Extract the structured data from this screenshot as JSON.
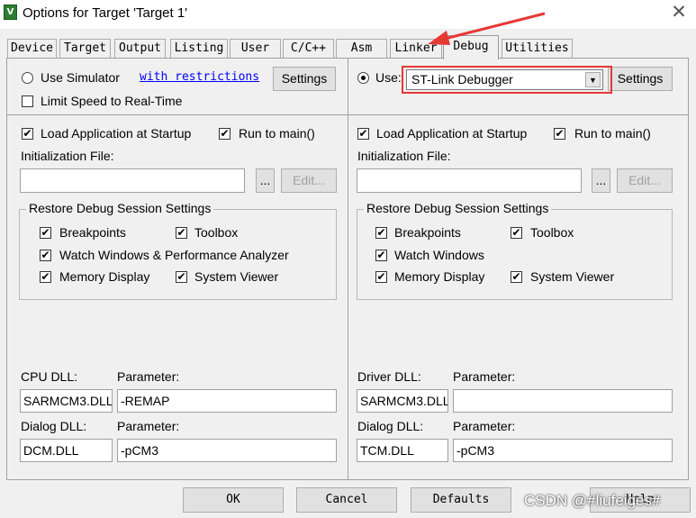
{
  "window": {
    "title": "Options for Target 'Target 1'",
    "app_icon_glyph": "V",
    "close_glyph": "✕"
  },
  "tabs": [
    "Device",
    "Target",
    "Output",
    "Listing",
    "User",
    "C/C++",
    "Asm",
    "Linker",
    "Debug",
    "Utilities"
  ],
  "active_tab": "Debug",
  "accent_color": "#e53935",
  "left": {
    "use_simulator_label": "Use Simulator",
    "use_simulator_selected": false,
    "restrictions_link": "with restrictions",
    "settings_label": "Settings",
    "limit_speed_label": "Limit Speed to Real-Time",
    "limit_speed_checked": false,
    "load_app_label": "Load Application at Startup",
    "load_app_checked": true,
    "run_main_label": "Run to main()",
    "run_main_checked": true,
    "init_file_label": "Initialization File:",
    "init_file_value": "",
    "browse_label": "...",
    "edit_label": "Edit...",
    "restore_group_title": "Restore Debug Session Settings",
    "breakpoints_label": "Breakpoints",
    "toolbox_label": "Toolbox",
    "watch_label": "Watch Windows & Performance Analyzer",
    "memory_label": "Memory Display",
    "sysviewer_label": "System Viewer",
    "dll_label": "CPU DLL:",
    "dll_value": "SARMCM3.DLL",
    "param_label": "Parameter:",
    "param_value": "-REMAP",
    "dialog_dll_label": "Dialog DLL:",
    "dialog_dll_value": "DCM.DLL",
    "dialog_param_label": "Parameter:",
    "dialog_param_value": "-pCM3"
  },
  "right": {
    "use_label": "Use:",
    "use_selected": true,
    "debugger_value": "ST-Link Debugger",
    "settings_label": "Settings",
    "load_app_label": "Load Application at Startup",
    "run_main_label": "Run to main()",
    "init_file_label": "Initialization File:",
    "init_file_value": "",
    "browse_label": "...",
    "edit_label": "Edit...",
    "restore_group_title": "Restore Debug Session Settings",
    "breakpoints_label": "Breakpoints",
    "toolbox_label": "Toolbox",
    "watch_label": "Watch Windows",
    "memory_label": "Memory Display",
    "sysviewer_label": "System Viewer",
    "dll_label": "Driver DLL:",
    "dll_value": "SARMCM3.DLL",
    "param_label": "Parameter:",
    "param_value": "",
    "dialog_dll_label": "Dialog DLL:",
    "dialog_dll_value": "TCM.DLL",
    "dialog_param_label": "Parameter:",
    "dialog_param_value": "-pCM3"
  },
  "footer": {
    "ok_label": "OK",
    "cancel_label": "Cancel",
    "defaults_label": "Defaults",
    "help_label": "Help"
  },
  "watermark": "CSDN @#liufeiges#"
}
